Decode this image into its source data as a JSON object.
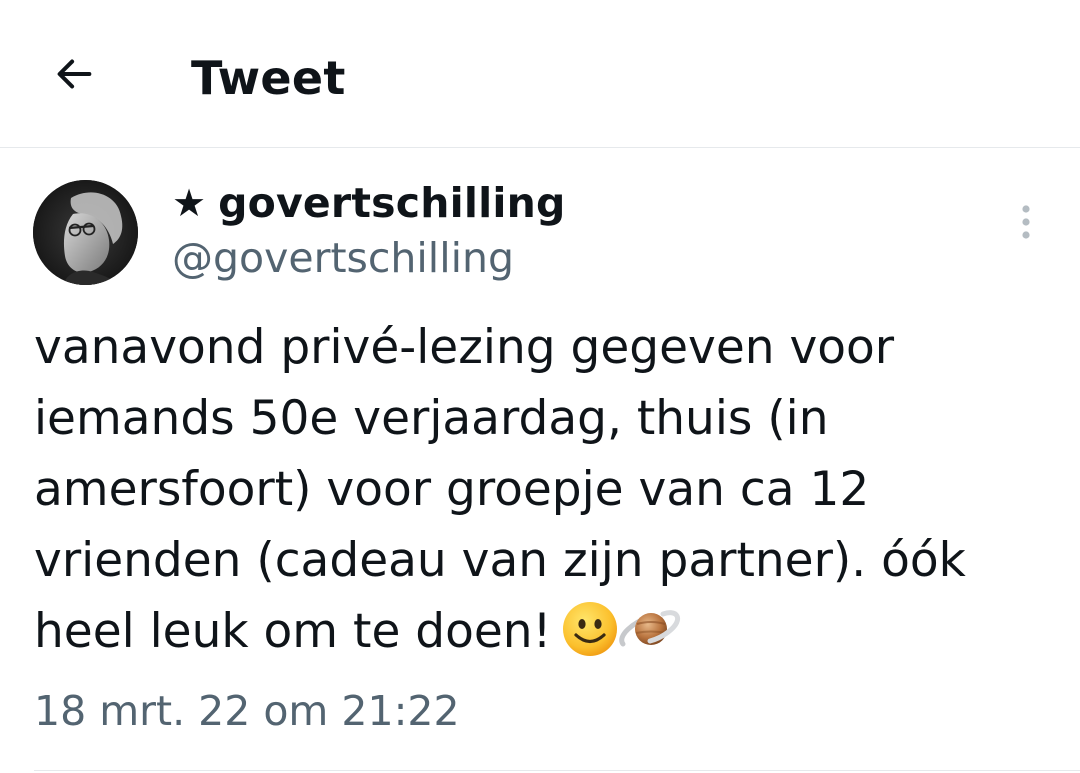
{
  "header": {
    "title": "Tweet",
    "back_icon": "arrow-left-icon"
  },
  "author": {
    "star": "★",
    "display_name": "govertschilling",
    "handle": "@govertschilling",
    "avatar_icon": "avatar-photo"
  },
  "tweet": {
    "text": "vanavond privé-lezing gegeven voor\niemands 50e verjaardag, thuis (in\namersfoort) voor groepje van ca 12\nvrienden (cadeau van zijn partner). óók\nheel leuk om te doen!",
    "emojis": [
      "smiling-face-icon",
      "ringed-planet-icon"
    ],
    "timestamp": "18 mrt. 22 om 21:22"
  },
  "colors": {
    "text_primary": "#0f1419",
    "text_secondary": "#536471",
    "divider": "#e6e9ec",
    "background": "#ffffff"
  }
}
